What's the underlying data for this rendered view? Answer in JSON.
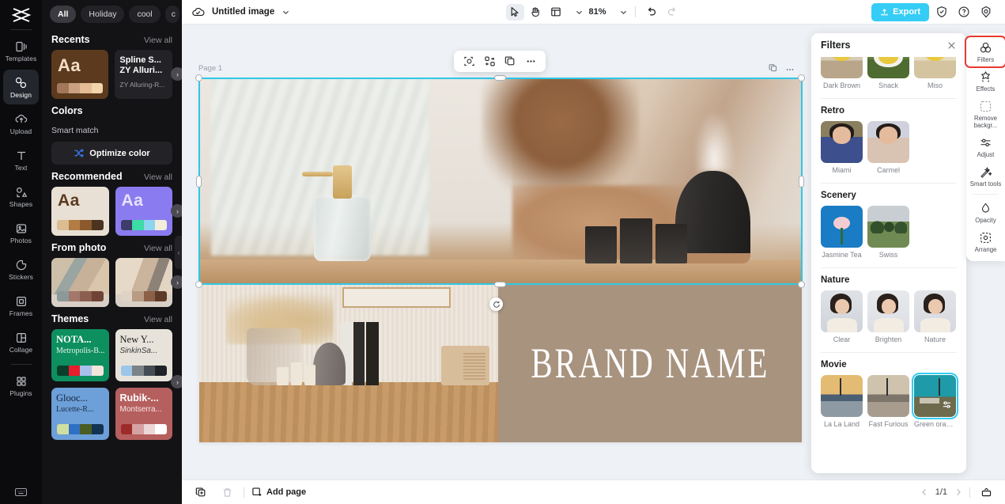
{
  "rail": {
    "logo": "capcut-logo",
    "items": [
      {
        "label": "Templates",
        "icon": "templates-icon",
        "active": false
      },
      {
        "label": "Design",
        "icon": "design-icon",
        "active": true
      },
      {
        "label": "Upload",
        "icon": "upload-icon",
        "active": false
      },
      {
        "label": "Text",
        "icon": "text-icon",
        "active": false
      },
      {
        "label": "Shapes",
        "icon": "shapes-icon",
        "active": false
      },
      {
        "label": "Photos",
        "icon": "photos-icon",
        "active": false
      },
      {
        "label": "Stickers",
        "icon": "stickers-icon",
        "active": false
      },
      {
        "label": "Frames",
        "icon": "frames-icon",
        "active": false
      },
      {
        "label": "Collage",
        "icon": "collage-icon",
        "active": false
      },
      {
        "label": "Plugins",
        "icon": "plugins-icon",
        "active": false
      }
    ],
    "bottom_icon": "keyboard-icon"
  },
  "panel": {
    "chips": [
      {
        "label": "All",
        "active": true
      },
      {
        "label": "Holiday",
        "active": false
      },
      {
        "label": "cool",
        "active": false
      },
      {
        "label": "c",
        "active": false
      }
    ],
    "sections": {
      "recents": {
        "title": "Recents",
        "view_all": "View all",
        "card1": {
          "sample": "Aa",
          "colors": [
            "#a2775a",
            "#c9a181",
            "#e4bd96",
            "#f3d5ac"
          ]
        },
        "card2": {
          "line1": "Spline S...",
          "line2": "ZY Alluri...",
          "line3": "ZY Alluring-R..."
        }
      },
      "colors": {
        "title": "Colors",
        "smart_match": "Smart match",
        "optimize_label": "Optimize color"
      },
      "recommended": {
        "title": "Recommended",
        "view_all": "View all",
        "card1": {
          "sample": "Aa",
          "bg": "#e8e0d4",
          "fg": "#5b3a22",
          "colors": [
            "#dcbd91",
            "#b27c44",
            "#8a5a2c",
            "#4c3320"
          ]
        },
        "card2": {
          "sample": "Aa",
          "bg": "#8b7bf0",
          "fg": "#e7e2ff",
          "colors": [
            "#3f3c6b",
            "#3ddba6",
            "#8fd5f2",
            "#f2eedc"
          ]
        }
      },
      "from_photo": {
        "title": "From photo",
        "view_all": "View all",
        "card1": {
          "colors": [
            "#8b9a98",
            "#a3786a",
            "#8b5f4f",
            "#6f4436"
          ]
        },
        "card2": {
          "colors": [
            "#e0d3c5",
            "#b99b83",
            "#8c6047",
            "#5d3a28"
          ]
        }
      },
      "themes": {
        "title": "Themes",
        "view_all": "View all",
        "cards": [
          {
            "t1": "NOTA...",
            "t2": "Metropolis-B...",
            "bg": "#0d8f5f",
            "fg": "#ffffff",
            "colors": [
              "#0a3f2b",
              "#e81d2c",
              "#a8c0ea",
              "#f2e6dc"
            ]
          },
          {
            "t1": "New Y...",
            "t2": "SinkinSa...",
            "bg": "#e8e3da",
            "fg": "#1b1c1e",
            "colors": [
              "#9cc5ea",
              "#7b8288",
              "#464c53",
              "#1f2327"
            ]
          },
          {
            "t1": "Glooc...",
            "t2": "Lucette-R...",
            "bg": "#6d9fd8",
            "fg": "#1b2a3a",
            "colors": [
              "#cfdfa0",
              "#3070c4",
              "#4a5d23",
              "#133352"
            ]
          },
          {
            "t1": "Rubik-...",
            "t2": "Montserra...",
            "bg": "#b65f5f",
            "fg": "#ffffff",
            "colors": [
              "#9e2a2a",
              "#d6a1a1",
              "#edd6d6",
              "#ffffff"
            ]
          }
        ]
      }
    }
  },
  "topbar": {
    "cloud_icon": "cloud-saved-icon",
    "title": "Untitled image",
    "title_caret": "chevron-down-icon",
    "tools": [
      {
        "name": "cursor-tool",
        "selected": true
      },
      {
        "name": "hand-tool",
        "selected": false
      },
      {
        "name": "layout-tool",
        "selected": false
      }
    ],
    "zoom": "81%",
    "undo": "undo-icon",
    "redo": "redo-icon",
    "export_label": "Export",
    "export_color": "#35cdf5",
    "right_icons": [
      "shield-check-icon",
      "help-icon",
      "settings-icon"
    ]
  },
  "canvas": {
    "page_label": "Page 1",
    "float_toolbar": [
      "crop-icon",
      "replace-icon",
      "duplicate-icon",
      "more-icon"
    ],
    "mini_icons": [
      "duplicate-icon",
      "more-icon"
    ],
    "brand_text": "BRAND NAME",
    "brand_bg": "#a8937f",
    "selection_color": "#2fc8e8"
  },
  "filters_panel": {
    "title": "Filters",
    "close_icon": "close-icon",
    "groups": [
      {
        "title": "",
        "items": [
          {
            "label": "Dark Brown",
            "thumb": "t-darkbrown",
            "selected": false
          },
          {
            "label": "Snack",
            "thumb": "t-snack",
            "selected": false
          },
          {
            "label": "Miso",
            "thumb": "t-miso",
            "selected": false
          }
        ]
      },
      {
        "title": "Retro",
        "items": [
          {
            "label": "Miami",
            "thumb": "t-miami",
            "selected": false
          },
          {
            "label": "Carmel",
            "thumb": "t-carmel",
            "selected": false
          }
        ]
      },
      {
        "title": "Scenery",
        "items": [
          {
            "label": "Jasmine Tea",
            "thumb": "t-jasmine",
            "selected": false
          },
          {
            "label": "Swiss",
            "thumb": "t-swiss",
            "selected": false
          }
        ]
      },
      {
        "title": "Nature",
        "items": [
          {
            "label": "Clear",
            "thumb": "t-clear",
            "selected": false
          },
          {
            "label": "Brighten",
            "thumb": "t-brighten",
            "selected": false
          },
          {
            "label": "Nature",
            "thumb": "t-nature",
            "selected": false
          }
        ]
      },
      {
        "title": "Movie",
        "items": [
          {
            "label": "La La Land",
            "thumb": "t-lala",
            "selected": false
          },
          {
            "label": "Fast Furious",
            "thumb": "t-fast",
            "selected": false
          },
          {
            "label": "Green oran...",
            "thumb": "t-green",
            "selected": true
          }
        ]
      }
    ]
  },
  "toolrail": {
    "items": [
      {
        "label": "Filters",
        "icon": "filters-icon",
        "selected": true
      },
      {
        "label": "Effects",
        "icon": "effects-icon",
        "selected": false
      },
      {
        "label": "Remove backgr...",
        "icon": "remove-background-icon",
        "selected": false
      },
      {
        "label": "Adjust",
        "icon": "adjust-icon",
        "selected": false
      },
      {
        "label": "Smart tools",
        "icon": "smart-tools-icon",
        "selected": false
      },
      {
        "label": "Opacity",
        "icon": "opacity-icon",
        "selected": false
      },
      {
        "label": "Arrange",
        "icon": "arrange-icon",
        "selected": false
      }
    ],
    "selection_outline": "#e8392f"
  },
  "bottombar": {
    "duplicate_icon": "duplicate-page-icon",
    "delete_icon": "trash-icon",
    "add_page_label": "Add page",
    "page_indicator": "1/1",
    "prev_icon": "chevron-left-icon",
    "next_icon": "chevron-right-icon",
    "timeline_icon": "timeline-icon"
  }
}
